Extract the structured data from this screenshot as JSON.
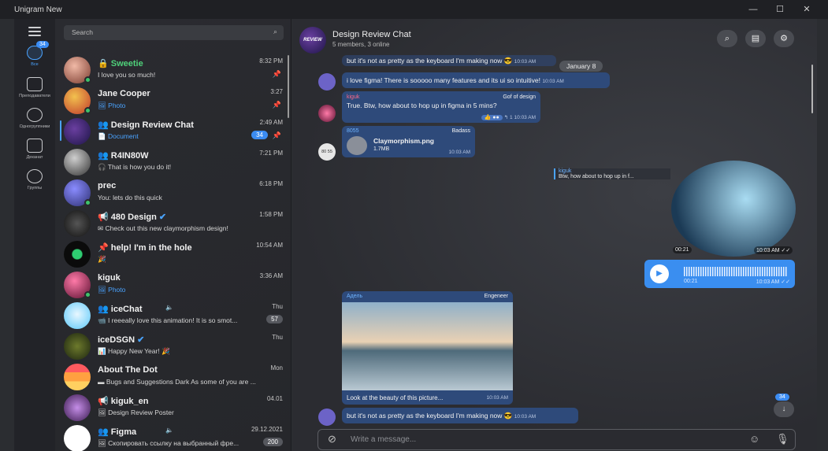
{
  "window": {
    "title": "Unigram New",
    "controls": [
      "—",
      "☐",
      "✕"
    ]
  },
  "rail": {
    "items": [
      {
        "label": "Все",
        "badge": "34"
      },
      {
        "label": "Преподаватели"
      },
      {
        "label": "Одногруппники"
      },
      {
        "label": "Деканат"
      },
      {
        "label": "Группы"
      }
    ]
  },
  "search": {
    "placeholder": "Search"
  },
  "chats": [
    {
      "name": "Sweetie",
      "preview": "I love you so much!",
      "time": "8:32 PM",
      "pinned": true
    },
    {
      "name": "Jane Cooper",
      "preview": "Photo",
      "time": "3:27",
      "pinned": true
    },
    {
      "name": "Design Review Chat",
      "preview": "Document",
      "time": "2:49 AM",
      "count": "34",
      "pinned": true
    },
    {
      "name": "R4IN80W",
      "preview": "That is how you do it!",
      "time": "7:21 PM"
    },
    {
      "name": "prec",
      "preview": "You: lets do this quick",
      "time": "6:18 PM"
    },
    {
      "name": "480 Design",
      "preview": "Check out this new claymorphism design!",
      "time": "1:58 PM"
    },
    {
      "name": "help! I'm in the hole",
      "preview": "🎉",
      "time": "10:54 AM"
    },
    {
      "name": "kiguk",
      "preview": "Photo",
      "time": "3:36 AM"
    },
    {
      "name": "iceChat",
      "preview": "I reeeally love this animation! It is so smot...",
      "time": "Thu",
      "count": "57"
    },
    {
      "name": "iceDSGN",
      "preview": "Happy New Year! 🎉",
      "time": "Thu"
    },
    {
      "name": "About The Dot",
      "preview": "Bugs and Suggestions Dark As some of you are ...",
      "time": "Mon"
    },
    {
      "name": "kiguk_en",
      "preview": "Design Review Poster",
      "time": "04.01"
    },
    {
      "name": "Figma",
      "preview": "Скопировать ссылку на выбранный фре...",
      "time": "29.12.2021",
      "count": "200"
    }
  ],
  "header": {
    "avatar_text": "REVIEW",
    "title": "Design Review Chat",
    "subtitle": "5 members, 3 online"
  },
  "messages": {
    "m1_text": "but it's not as pretty as the keyboard I'm making now 😎",
    "m1_time": "10:03 AM",
    "date_chip": "January 8",
    "m2_text": "i love figma! There is sooooo many features and its ui so intuitive!",
    "m2_time": "10:03 AM",
    "m3_author": "kiguk",
    "m3_tag": "Gof of design",
    "m3_text": "True. Btw, how about to hop up in figma in 5 mins?",
    "m3_reply_count": "1",
    "m3_time": "10:03 AM",
    "m4_author": "8055",
    "m4_tag": "Badass",
    "m4_file": "Claymorphism.png",
    "m4_size": "1.7MB",
    "m4_time": "10:03 AM",
    "m4_avatar": "80 55",
    "reply_author": "kiguk",
    "reply_text": "Btw, how about to hop up in f...",
    "video_duration": "00:21",
    "video_time": "10:03 AM",
    "voice_duration": "00:21",
    "voice_time": "10:03 AM",
    "photo_author": "Адель",
    "photo_tag": "Engeneer",
    "photo_caption": "Look at the beauty of this picture...",
    "photo_time": "10:03 AM",
    "m5_text": "but it's not as pretty as the keyboard I'm making now 😎",
    "m5_time": "10:03 AM"
  },
  "composer": {
    "placeholder": "Write a message..."
  },
  "scroll_badge": "34",
  "colors": {
    "accent": "#3b8cf3",
    "bubble": "#2e4a7a",
    "online": "#3ec36b"
  }
}
